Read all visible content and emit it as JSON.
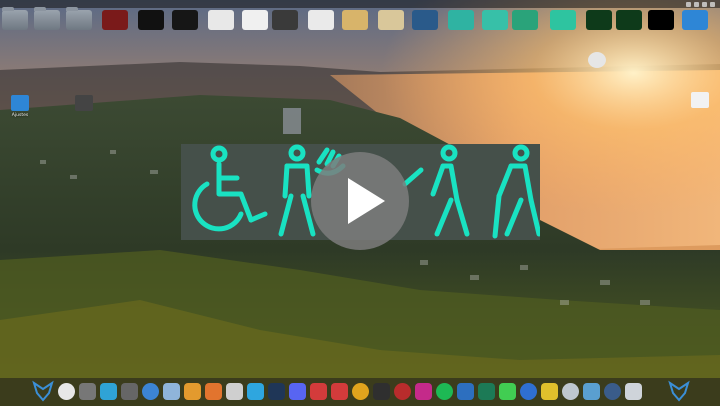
{
  "desktop": {
    "top_icons": [
      {
        "label": "",
        "kind": "folder",
        "color": "#7f8a96"
      },
      {
        "label": "",
        "kind": "folder",
        "color": "#7f8a96"
      },
      {
        "label": "",
        "kind": "folder",
        "color": "#7f8a96"
      },
      {
        "label": "",
        "kind": "image",
        "color": "#7a1a1a"
      },
      {
        "label": "",
        "kind": "image",
        "color": "#111111"
      },
      {
        "label": "",
        "kind": "image",
        "color": "#161616"
      },
      {
        "label": "",
        "kind": "image",
        "color": "#e8e8e8"
      },
      {
        "label": "",
        "kind": "image",
        "color": "#f0f0f0"
      },
      {
        "label": "",
        "kind": "image",
        "color": "#3a3a3a"
      },
      {
        "label": "",
        "kind": "image",
        "color": "#eaeaea"
      },
      {
        "label": "",
        "kind": "image",
        "color": "#d8b46a"
      },
      {
        "label": "",
        "kind": "image",
        "color": "#d9c79a"
      },
      {
        "label": "",
        "kind": "image",
        "color": "#2a5a8a"
      },
      {
        "label": "",
        "kind": "image",
        "color": "#2fb3a2"
      },
      {
        "label": "",
        "kind": "image",
        "color": "#37c0a8"
      },
      {
        "label": "",
        "kind": "image",
        "color": "#2aa37a"
      },
      {
        "label": "",
        "kind": "image",
        "color": "#2ec4a0"
      },
      {
        "label": "",
        "kind": "image",
        "color": "#0e3a1a"
      },
      {
        "label": "",
        "kind": "image",
        "color": "#0e3a1a"
      },
      {
        "label": "",
        "kind": "image",
        "color": "#000000"
      },
      {
        "label": "",
        "kind": "settings",
        "color": "#2e86d6"
      }
    ],
    "left_icons": [
      {
        "label": "Ajustes",
        "color": "#2e86d6"
      },
      {
        "label": "",
        "color": "#444444"
      }
    ],
    "right_icons": [
      {
        "label": "",
        "color": "#e6e6e6"
      },
      {
        "label": "",
        "color": "#f2f2f2"
      }
    ]
  },
  "video": {
    "play_label": "play",
    "glyph_color": "#19e2c2",
    "glyphs": [
      "wheelchair-user",
      "standing-person",
      "hand-signing",
      "walking-person",
      "person-with-cane"
    ]
  },
  "dock": {
    "items": [
      {
        "name": "logo",
        "color": "#3b8fd6"
      },
      {
        "name": "browser",
        "color": "#e7e7e7"
      },
      {
        "name": "files",
        "color": "#777777"
      },
      {
        "name": "layers",
        "color": "#2fa3d6"
      },
      {
        "name": "app",
        "color": "#666666"
      },
      {
        "name": "app",
        "color": "#3c84d3"
      },
      {
        "name": "folder",
        "color": "#8fb4da"
      },
      {
        "name": "media",
        "color": "#e39a2e"
      },
      {
        "name": "app",
        "color": "#e2742e"
      },
      {
        "name": "settings",
        "color": "#cfcfcf"
      },
      {
        "name": "telegram",
        "color": "#2ea6df"
      },
      {
        "name": "steam",
        "color": "#1f3657"
      },
      {
        "name": "discord",
        "color": "#5865f2"
      },
      {
        "name": "chat",
        "color": "#d33b3b"
      },
      {
        "name": "app",
        "color": "#d33b3b"
      },
      {
        "name": "app",
        "color": "#e0a41d"
      },
      {
        "name": "monitor",
        "color": "#2f2f2f"
      },
      {
        "name": "app",
        "color": "#b82c2c"
      },
      {
        "name": "app",
        "color": "#c42a8a"
      },
      {
        "name": "spotify",
        "color": "#1db954"
      },
      {
        "name": "app",
        "color": "#2d6fbf"
      },
      {
        "name": "terminal",
        "color": "#1c7a56"
      },
      {
        "name": "qt",
        "color": "#41cd52"
      },
      {
        "name": "accessibility",
        "color": "#2f6fd1"
      },
      {
        "name": "colors",
        "color": "#e0c02c"
      },
      {
        "name": "app",
        "color": "#bfc7cf"
      },
      {
        "name": "app",
        "color": "#5a9fd0"
      },
      {
        "name": "app",
        "color": "#3a5c8a"
      },
      {
        "name": "trash",
        "color": "#cfd4da"
      },
      {
        "name": "logo",
        "color": "#3b8fd6"
      }
    ]
  },
  "panel": {
    "clock": ""
  }
}
